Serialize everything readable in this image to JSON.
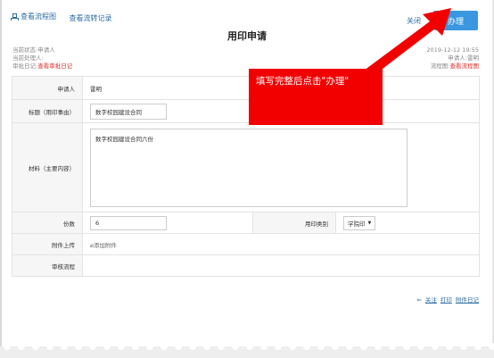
{
  "header": {
    "view_flowchart": "查看流程图",
    "view_circulation": "查看流转记录",
    "close_label": "关闭",
    "handle_label": "办理",
    "title": "用印申请"
  },
  "meta": {
    "current_status": "当前状态:申请人",
    "current_handler": "当前处理人:",
    "approval_log_prefix": "审批日记:",
    "approval_log_link": "查看审批日记",
    "date": "2019-12-12 19:55",
    "applicant": "申请人:雷明",
    "flowchart_prefix": "流程图:",
    "flowchart_link": "查看流程图"
  },
  "form": {
    "applicant_label": "申请人",
    "applicant_value": "雷明",
    "subject_label": "标题（用印事由）",
    "subject_value": "数字校园建设合同",
    "material_label": "材料（主要内容）",
    "material_value": "数字校园建设合同六份",
    "copies_label": "份数",
    "copies_value": "6",
    "seal_type_label": "用印类别",
    "seal_type_value": "学院印",
    "attachment_label": "附件上传",
    "attachment_link": "添加附件",
    "review_label": "审核流程",
    "review_value": ""
  },
  "footer": {
    "follow": "关注",
    "print": "打印",
    "attachment_log": "附件日记"
  },
  "annotation": {
    "text": "填写完整后点击\"办理\"",
    "color": "#f20000"
  },
  "colors": {
    "accent": "#3a97e0",
    "link": "#2e6da4",
    "highlight": "#d9302c"
  }
}
